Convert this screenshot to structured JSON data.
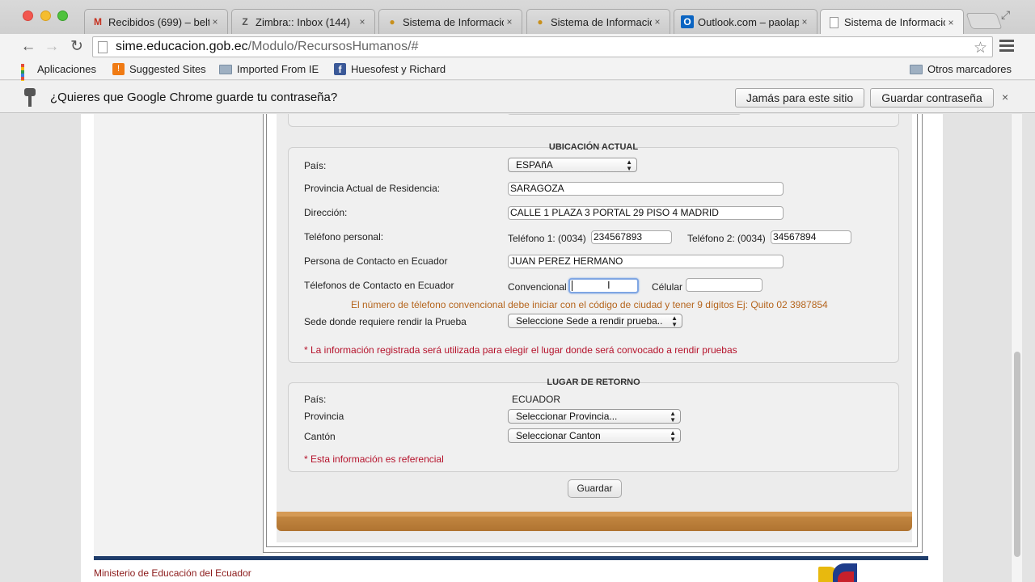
{
  "browser": {
    "tabs": [
      {
        "label": "Recibidos (699) – belt",
        "icon": "gmail-icon",
        "glyph": "M",
        "glyph_color": "#c5301e"
      },
      {
        "label": "Zimbra:: Inbox (144)",
        "icon": "zimbra-icon",
        "glyph": "Z",
        "glyph_color": "#555555"
      },
      {
        "label": "Sistema de Informacio",
        "icon": "sime-icon",
        "glyph": "●",
        "glyph_color": "#c8901c"
      },
      {
        "label": "Sistema de Informacio",
        "icon": "sime-icon",
        "glyph": "●",
        "glyph_color": "#c8901c"
      },
      {
        "label": "Outlook.com – paolap",
        "icon": "outlook-icon",
        "glyph": "O",
        "glyph_color": "#0a64c2"
      },
      {
        "label": "Sistema de Informacio",
        "icon": "page-icon",
        "glyph": "",
        "glyph_color": "#888888"
      }
    ],
    "close_glyph": "×",
    "url_host": "sime.educacion.gob.ec",
    "url_path": "/Modulo/RecursosHumanos/#",
    "bookmarks": [
      {
        "label": "Aplicaciones"
      },
      {
        "label": "Suggested Sites"
      },
      {
        "label": "Imported From IE"
      },
      {
        "label": "Huesofest y Richard"
      },
      {
        "label": "Otros marcadores"
      }
    ],
    "infobar": {
      "text": "¿Quieres que Google Chrome guarde tu contraseña?",
      "never_label": "Jamás para este sitio",
      "save_label": "Guardar contraseña"
    }
  },
  "form": {
    "ubicacion": {
      "title": "UBICACIÓN ACTUAL",
      "pais_label": "País:",
      "pais_value": "ESPAñA",
      "provincia_label": "Provincia Actual de Residencia:",
      "provincia_value": "SARAGOZA",
      "direccion_label": "Dirección:",
      "direccion_value": "CALLE 1 PLAZA 3 PORTAL 29 PISO 4 MADRID",
      "telefono_label": "Teléfono personal:",
      "tel1_label": "Teléfono 1: (0034)",
      "tel1_value": "234567893",
      "tel2_label": "Teléfono 2: (0034)",
      "tel2_value": "34567894",
      "contacto_label": "Persona de Contacto en Ecuador",
      "contacto_value": "JUAN PEREZ HERMANO",
      "tel_contacto_label": "Télefonos de Contacto en Ecuador",
      "convencional_label": "Convencional",
      "convencional_value": "",
      "celular_label": "Célular",
      "celular_value": "",
      "convencional_note": "El número de télefono convencional debe iniciar con el código de ciudad y tener 9 dígitos Ej: Quito 02 3987854",
      "sede_label": "Sede donde requiere rendir la Prueba",
      "sede_value": "Seleccione Sede a rendir prueba..",
      "sede_note": "* La información registrada será utilizada para elegir el lugar donde será convocado a rendir pruebas"
    },
    "retorno": {
      "title": "LUGAR DE RETORNO",
      "pais_label": "País:",
      "pais_value": "ECUADOR",
      "provincia_label": "Provincia",
      "provincia_value": "Seleccionar Provincia...",
      "canton_label": "Cantón",
      "canton_value": "Seleccionar Canton",
      "note": "* Esta información es referencial"
    },
    "submit_label": "Guardar"
  },
  "footer": {
    "text": "Ministerio de Educación del Ecuador"
  }
}
